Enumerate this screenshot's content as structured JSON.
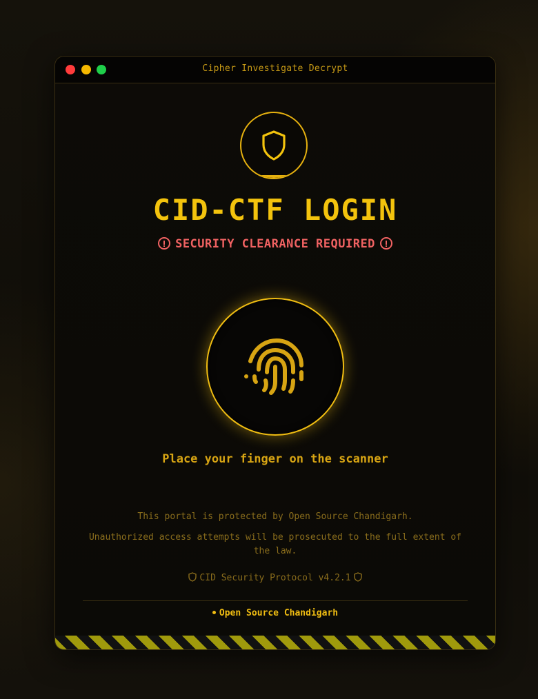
{
  "window": {
    "title": "Cipher Investigate Decrypt",
    "controls": [
      "close",
      "minimize",
      "maximize"
    ]
  },
  "header": {
    "badge_icon": "shield-icon",
    "title": "CID-CTF LOGIN",
    "warning": "SECURITY CLEARANCE REQUIRED",
    "warning_icon": "alert-circle-icon"
  },
  "scanner": {
    "icon": "fingerprint-icon",
    "prompt": "Place your finger on the scanner"
  },
  "notices": {
    "line1": "This portal is protected by Open Source Chandigarh.",
    "line2": "Unauthorized access attempts will be prosecuted to the full extent of the law."
  },
  "protocol": {
    "label": "CID Security Protocol v4.2.1",
    "icon": "shield-icon"
  },
  "footer": {
    "brand": "Open Source Chandigarh"
  },
  "colors": {
    "accent": "#f3c30d",
    "warning": "#f06262",
    "muted": "#8a6d1c",
    "background": "#0b0a06"
  }
}
